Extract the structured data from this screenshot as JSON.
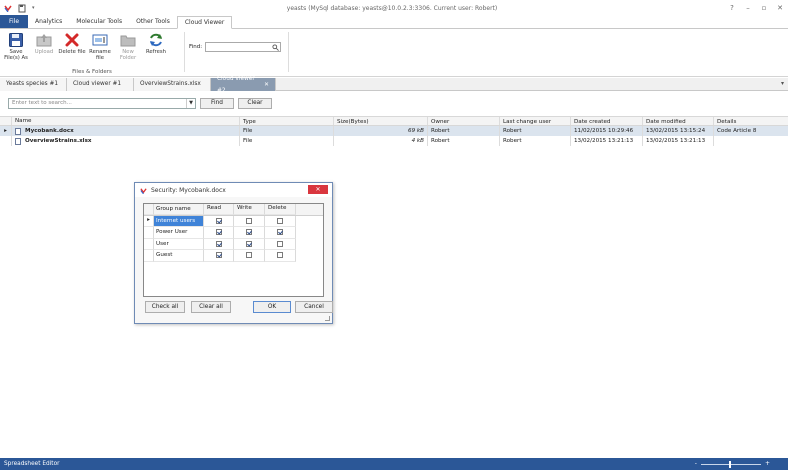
{
  "window": {
    "title": "yeasts (MySql database: yeasts@10.0.2.3:3306. Current user: Robert)",
    "controls": [
      "?",
      "–",
      "▫",
      "✕"
    ]
  },
  "ribbon": {
    "tabs": [
      "File",
      "Analytics",
      "Molecular Tools",
      "Other Tools",
      "Cloud Viewer"
    ],
    "active_tab": "Cloud Viewer",
    "buttons": [
      {
        "label": "Save File(s) As",
        "icon": "save-disk-icon",
        "enabled": true
      },
      {
        "label": "Upload",
        "icon": "upload-icon",
        "enabled": false
      },
      {
        "label": "Delete file",
        "icon": "delete-x-icon",
        "enabled": true
      },
      {
        "label": "Rename file",
        "icon": "rename-icon",
        "enabled": true
      },
      {
        "label": "New Folder",
        "icon": "new-folder-icon",
        "enabled": false
      },
      {
        "label": "Refresh",
        "icon": "refresh-icon",
        "enabled": true
      }
    ],
    "group_label": "Files & Folders",
    "find_label": "Find:",
    "find_value": ""
  },
  "doc_tabs": [
    "Yeasts species #1",
    "Cloud viewer #1",
    "OverviewStrains.xlsx",
    "Cloud viewer #2"
  ],
  "active_doc_tab": "Cloud viewer #2",
  "search": {
    "placeholder": "Enter text to search...",
    "find_button": "Find",
    "clear_button": "Clear"
  },
  "file_grid": {
    "columns": [
      "Name",
      "Type",
      "Size(Bytes)",
      "Owner",
      "Last change user",
      "Date created",
      "Date modified",
      "Details"
    ],
    "rows": [
      {
        "name": "Mycobank.docx",
        "type": "File",
        "size": "69 kB",
        "owner": "Robert",
        "last_change_user": "Robert",
        "date_created": "11/02/2015 10:29:46",
        "date_modified": "13/02/2015 13:15:24",
        "details": "Code Article 8"
      },
      {
        "name": "OverviewStrains.xlsx",
        "type": "File",
        "size": "4 kB",
        "owner": "Robert",
        "last_change_user": "Robert",
        "date_created": "13/02/2015 13:21:13",
        "date_modified": "13/02/2015 13:21:13",
        "details": ""
      }
    ]
  },
  "security_dialog": {
    "title": "Security: Mycobank.docx",
    "columns": [
      "Group name",
      "Read",
      "Write",
      "Delete"
    ],
    "rows": [
      {
        "group": "Internet users",
        "read": true,
        "write": false,
        "delete": false
      },
      {
        "group": "Power User",
        "read": true,
        "write": true,
        "delete": true
      },
      {
        "group": "User",
        "read": true,
        "write": true,
        "delete": false
      },
      {
        "group": "Guest",
        "read": true,
        "write": false,
        "delete": false
      }
    ],
    "buttons": {
      "check_all": "Check all",
      "clear_all": "Clear all",
      "ok": "OK",
      "cancel": "Cancel"
    }
  },
  "statusbar": {
    "text": "Spreadsheet Editor",
    "zoom_minus": "-",
    "zoom_plus": "+"
  },
  "colors": {
    "accent": "#2b5797",
    "selected_row": "#dbe4ee",
    "close_button": "#d9363e",
    "selected_cell": "#3f83d8"
  }
}
